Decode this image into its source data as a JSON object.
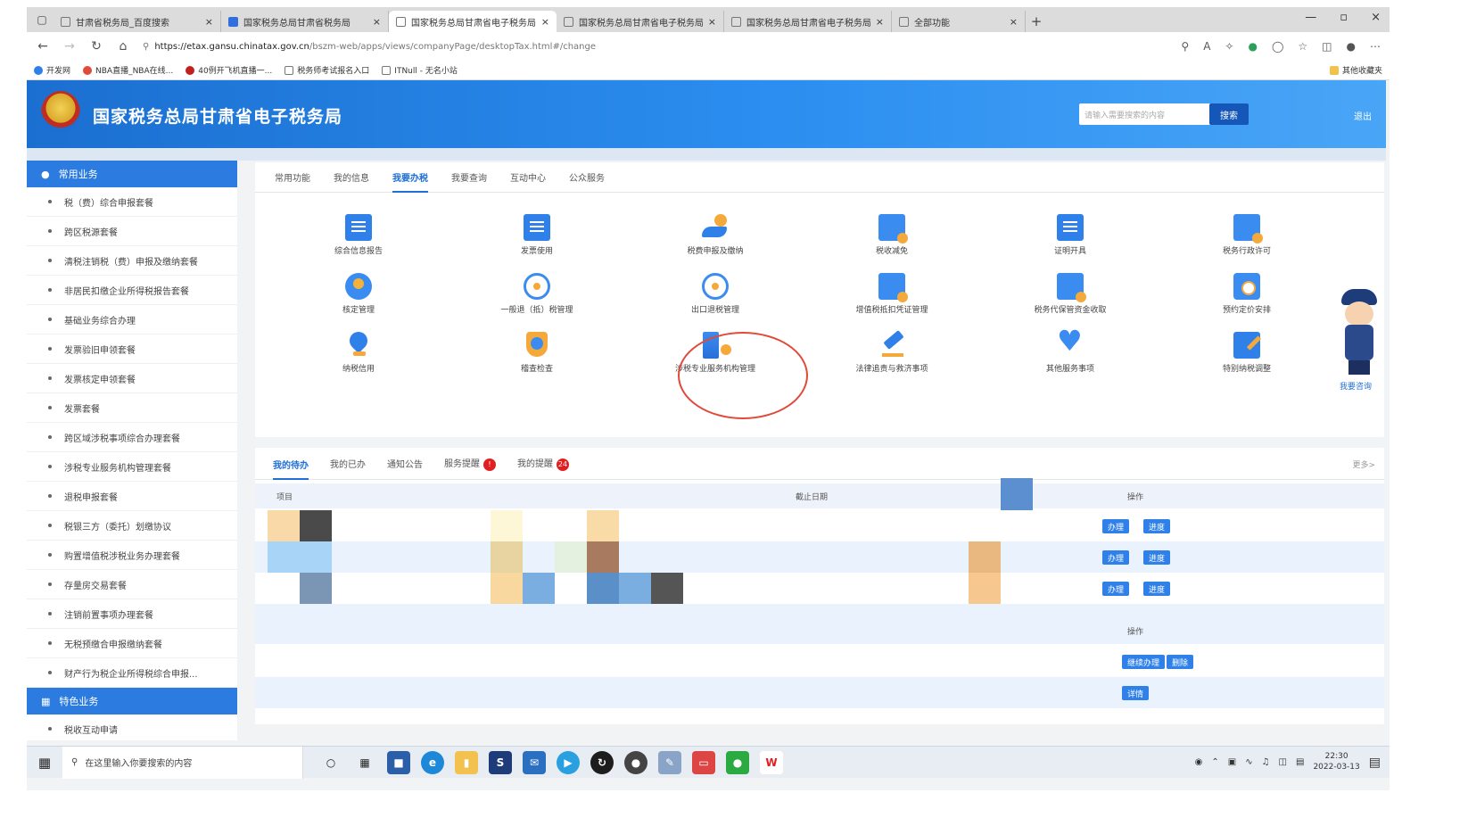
{
  "browser": {
    "tabs": [
      {
        "title": "甘肃省税务局_百度搜索",
        "active": false
      },
      {
        "title": "国家税务总局甘肃省税务局",
        "active": false
      },
      {
        "title": "国家税务总局甘肃省电子税务局",
        "active": true
      },
      {
        "title": "国家税务总局甘肃省电子税务局",
        "active": false
      },
      {
        "title": "国家税务总局甘肃省电子税务局",
        "active": false
      },
      {
        "title": "全部功能",
        "active": false
      }
    ],
    "url_domain": "https://etax.gansu.chinatax.gov.cn",
    "url_path": "/bszm-web/apps/views/companyPage/desktopTax.html#/change",
    "bookmarks": [
      "开发网",
      "NBA直播_NBA在线...",
      "40例开飞机直播一...",
      "税务师考试报名入口",
      "ITNull - 无名小站"
    ],
    "bookmarks_right": "其他收藏夹"
  },
  "site": {
    "title": "国家税务总局甘肃省电子税务局",
    "search_placeholder": "请输入需要搜索的内容",
    "search_button": "搜索",
    "logout": "退出"
  },
  "sidebar": {
    "section1": "常用业务",
    "items": [
      "税（费）综合申报套餐",
      "跨区税源套餐",
      "清税注销税（费）申报及缴纳套餐",
      "非居民扣缴企业所得税报告套餐",
      "基础业务综合办理",
      "发票验旧申领套餐",
      "发票核定申领套餐",
      "发票套餐",
      "跨区域涉税事项综合办理套餐",
      "涉税专业服务机构管理套餐",
      "退税申报套餐",
      "税银三方（委托）划缴协议",
      "购置增值税涉税业务办理套餐",
      "存量房交易套餐",
      "注销前置事项办理套餐",
      "无税预缴合申报缴纳套餐",
      "财产行为税企业所得税综合申报..."
    ],
    "section2": "特色业务",
    "items2": [
      "税收互动申请"
    ]
  },
  "nav_tabs": [
    "常用功能",
    "我的信息",
    "我要办税",
    "我要查询",
    "互动中心",
    "公众服务"
  ],
  "nav_active": 2,
  "functions": [
    {
      "label": "综合信息报告",
      "icon": "document-report-icon"
    },
    {
      "label": "发票使用",
      "icon": "invoice-icon"
    },
    {
      "label": "税费申报及缴纳",
      "icon": "tax-payment-hand-icon"
    },
    {
      "label": "税收减免",
      "icon": "tax-reduction-card-icon"
    },
    {
      "label": "证明开具",
      "icon": "certificate-icon"
    },
    {
      "label": "税务行政许可",
      "icon": "admin-permit-icon"
    },
    {
      "label": "核定管理",
      "icon": "assessment-badge-icon"
    },
    {
      "label": "一般退（抵）税管理",
      "icon": "refund-gear-icon"
    },
    {
      "label": "出口退税管理",
      "icon": "export-refund-icon"
    },
    {
      "label": "增值税抵扣凭证管理",
      "icon": "vat-voucher-card-icon"
    },
    {
      "label": "税务代保管资金收取",
      "icon": "custody-fund-icon"
    },
    {
      "label": "预约定价安排",
      "icon": "pricing-calendar-icon"
    },
    {
      "label": "纳税信用",
      "icon": "credit-pin-icon"
    },
    {
      "label": "稽查检查",
      "icon": "inspection-shield-icon"
    },
    {
      "label": "涉税专业服务机构管理",
      "icon": "agency-building-icon"
    },
    {
      "label": "法律追责与救济事项",
      "icon": "law-hammer-icon"
    },
    {
      "label": "其他服务事项",
      "icon": "service-heart-icon"
    },
    {
      "label": "特别纳税调整",
      "icon": "special-adjust-edit-icon"
    }
  ],
  "mascot_label": "我要咨询",
  "bottom_tabs": [
    {
      "label": "我的待办",
      "badge": ""
    },
    {
      "label": "我的已办",
      "badge": ""
    },
    {
      "label": "通知公告",
      "badge": ""
    },
    {
      "label": "服务提醒",
      "badge": "!"
    },
    {
      "label": "我的提醒",
      "badge": "24"
    }
  ],
  "bottom_more": "更多>",
  "table": {
    "col_item": "项目",
    "col_deadline": "截止日期",
    "col_action": "操作",
    "btn_handle": "办理",
    "btn_progress": "进度",
    "col_action2": "操作",
    "btn_continue": "继续办理",
    "btn_delete": "删除",
    "btn_detail": "详情"
  },
  "taskbar": {
    "search_placeholder": "在这里输入你要搜索的内容",
    "time": "22:30",
    "date": "2022-03-13"
  },
  "colors": {
    "brand_blue": "#2b7be0",
    "highlight_red": "#e04a3a"
  }
}
